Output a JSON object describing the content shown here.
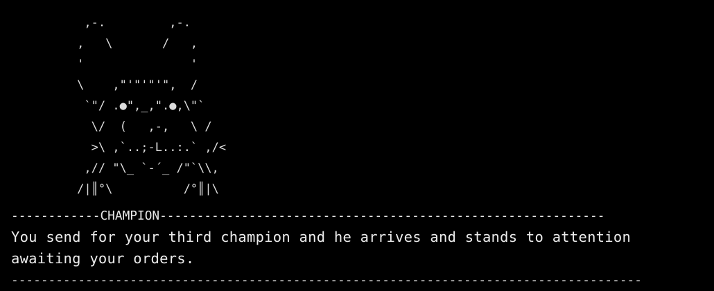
{
  "screen": {
    "art_lines": [
      "      ,-.         ,-.",
      "     ,   \\       /   ,",
      "     '               '",
      "     \\    ,\"'\"'\"'\",  /",
      "      `\"/ .●\",_,\".●,\\\"`",
      "       \\/  (   ,-,   \\ /",
      "       >\\ ,`..;-L..:.` ,/<",
      "      ,// \"\\_ `-´_ /\"`\\\\,",
      "     /|║°\\          /°║|\\"
    ],
    "divider_top": "------------CHAMPION------------------------------------------------------------",
    "message": "You send for your third champion and he arrives and stands to attention\nawaiting your orders.",
    "divider_bottom": "-------------------------------------------------------------------------------------"
  },
  "colors": {
    "background": "#000000",
    "text": "#ececec"
  }
}
